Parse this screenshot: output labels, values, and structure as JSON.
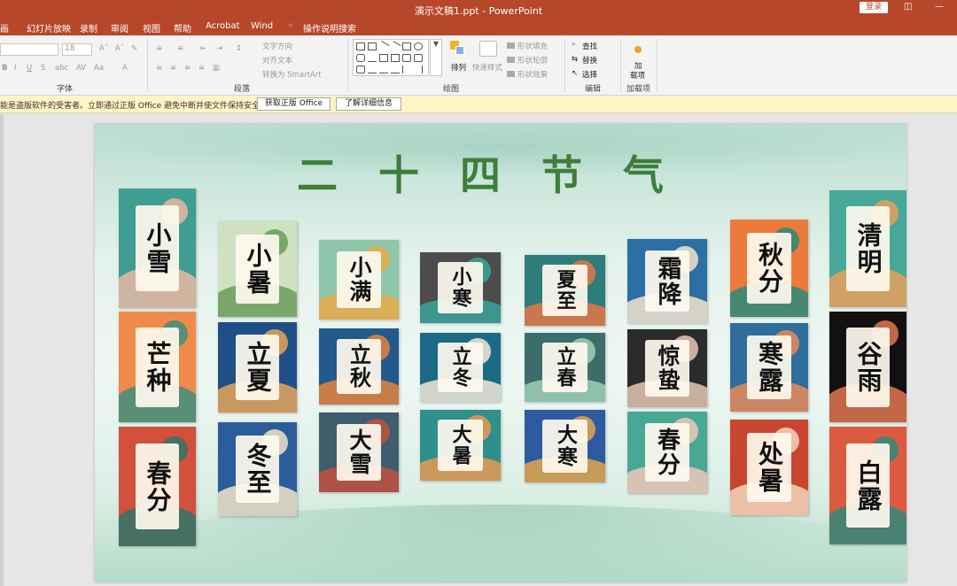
{
  "window": {
    "title": "演示文稿1.ppt - PowerPoint",
    "login_label": "登录",
    "restore_icon": "restore-icon",
    "minimize_icon": "minimize-icon"
  },
  "tabs": [
    {
      "label": "画"
    },
    {
      "label": "幻灯片放映"
    },
    {
      "label": "录制"
    },
    {
      "label": "审阅"
    },
    {
      "label": "视图"
    },
    {
      "label": "帮助"
    },
    {
      "label": "Acrobat"
    },
    {
      "label": "Wind"
    }
  ],
  "tell_me": {
    "label": "操作说明搜索",
    "icon": "lightbulb-icon"
  },
  "ribbon": {
    "font_size_value": "18",
    "text_direction": "文字方向",
    "align_text": "对齐文本",
    "convert_smartart": "转换为 SmartArt",
    "arrange": "排列",
    "quick_styles": "快速样式",
    "shape_fill": "形状填充",
    "shape_outline": "形状轮廓",
    "shape_effects": "形状效果",
    "find": "查找",
    "replace": "替换",
    "select": "选择",
    "addins_line1": "加",
    "addins_line2": "载项",
    "groups": {
      "font": "字体",
      "paragraph": "段落",
      "drawing": "绘图",
      "editing": "编辑",
      "addins": "加载项"
    }
  },
  "warning": {
    "message": "能是盗版软件的受害者。立即通过正版 Office 避免中断并使文件保持安全。",
    "btn_genuine": "获取正版 Office",
    "btn_learn": "了解详细信息"
  },
  "slide": {
    "title": "二十四节气",
    "cards": [
      {
        "label": "小雪",
        "bg": "#3f9d92",
        "accent": "#e9b8a2"
      },
      {
        "label": "芒种",
        "bg": "#f08a4b",
        "accent": "#3d8f7e"
      },
      {
        "label": "春分",
        "bg": "#d2503c",
        "accent": "#2e7567"
      },
      {
        "label": "小暑",
        "bg": "#cfe1c0",
        "accent": "#6a9c5b"
      },
      {
        "label": "立夏",
        "bg": "#1f4f86",
        "accent": "#e7a45a"
      },
      {
        "label": "冬至",
        "bg": "#2a5d9a",
        "accent": "#f1e3c8"
      },
      {
        "label": "小满",
        "bg": "#8ec7a9",
        "accent": "#e9a94a"
      },
      {
        "label": "立秋",
        "bg": "#235a8e",
        "accent": "#e5833b"
      },
      {
        "label": "大雪",
        "bg": "#3f5d6e",
        "accent": "#c1503e"
      },
      {
        "label": "小寒",
        "bg": "#4c4c4c",
        "accent": "#3aa39a"
      },
      {
        "label": "立冬",
        "bg": "#1d6a86",
        "accent": "#f2e9d6"
      },
      {
        "label": "大暑",
        "bg": "#2f8f8a",
        "accent": "#e99a52"
      },
      {
        "label": "夏至",
        "bg": "#2f7d7a",
        "accent": "#e57547"
      },
      {
        "label": "立春",
        "bg": "#3b6e6a",
        "accent": "#9fcfb7"
      },
      {
        "label": "大寒",
        "bg": "#2e5aa0",
        "accent": "#e3a64a"
      },
      {
        "label": "霜降",
        "bg": "#2c6fa4",
        "accent": "#f5e4cf"
      },
      {
        "label": "惊蛰",
        "bg": "#2b2b2b",
        "accent": "#e6c7b4"
      },
      {
        "label": "春分",
        "bg": "#49a894",
        "accent": "#f0c8b8"
      },
      {
        "label": "秋分",
        "bg": "#ec7a3c",
        "accent": "#2a8a7a"
      },
      {
        "label": "寒露",
        "bg": "#2f6e9c",
        "accent": "#e98a5a"
      },
      {
        "label": "处暑",
        "bg": "#c8452f",
        "accent": "#f2d6b8"
      },
      {
        "label": "清明",
        "bg": "#47a89a",
        "accent": "#e8a05b"
      },
      {
        "label": "谷雨",
        "bg": "#111111",
        "accent": "#e27650"
      },
      {
        "label": "白露",
        "bg": "#dc5b40",
        "accent": "#2f8a7b"
      }
    ]
  }
}
